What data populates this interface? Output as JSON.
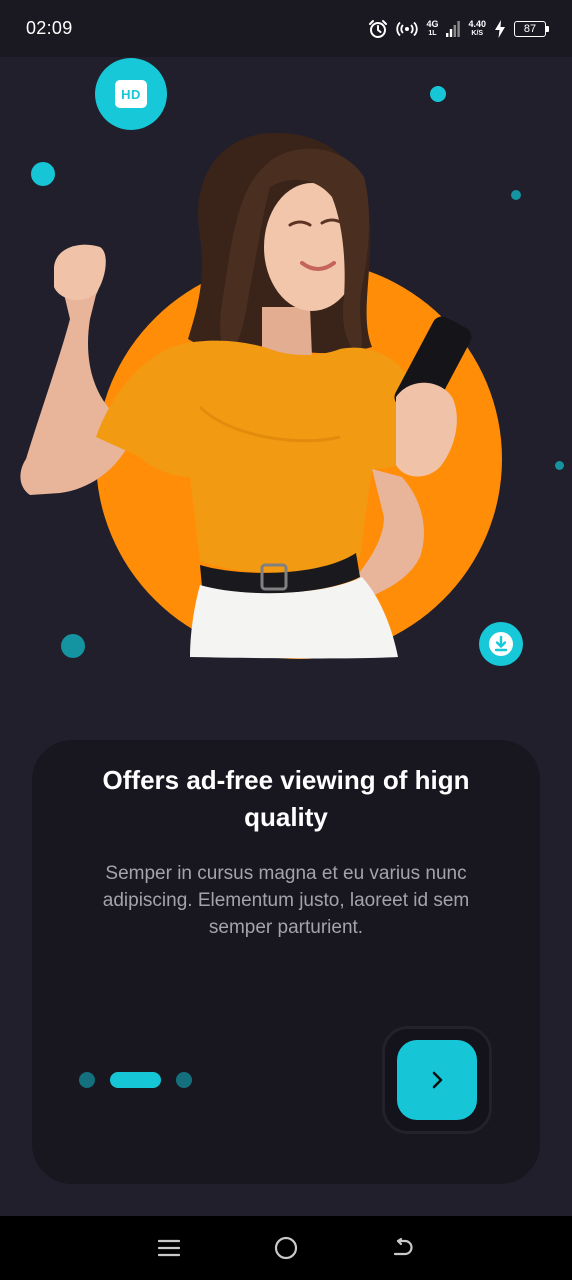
{
  "status_bar": {
    "time": "02:09",
    "network_type": "4G",
    "network_sub": "1L",
    "speed_value": "4.40",
    "speed_unit": "K/S",
    "battery": "87",
    "icons": [
      "alarm-icon",
      "hotspot-icon",
      "signal-icon",
      "charging-icon",
      "battery-icon"
    ]
  },
  "hero": {
    "badges": [
      "hd-icon",
      "download-icon"
    ],
    "hd_label": "HD",
    "colors": {
      "accent": "#16c6d6",
      "orange": "#ff8d07",
      "background": "#211f2b"
    }
  },
  "card": {
    "title": "Offers ad-free viewing of hign quality",
    "body": "Semper in cursus magna et eu varius nunc adipiscing. Elementum justo, laoreet id sem semper parturient.",
    "pager": {
      "count": 3,
      "active_index": 1
    },
    "next_icon": "chevron-right-icon"
  },
  "nav_bar": {
    "icons": [
      "menu-icon",
      "home-icon",
      "back-icon"
    ]
  }
}
